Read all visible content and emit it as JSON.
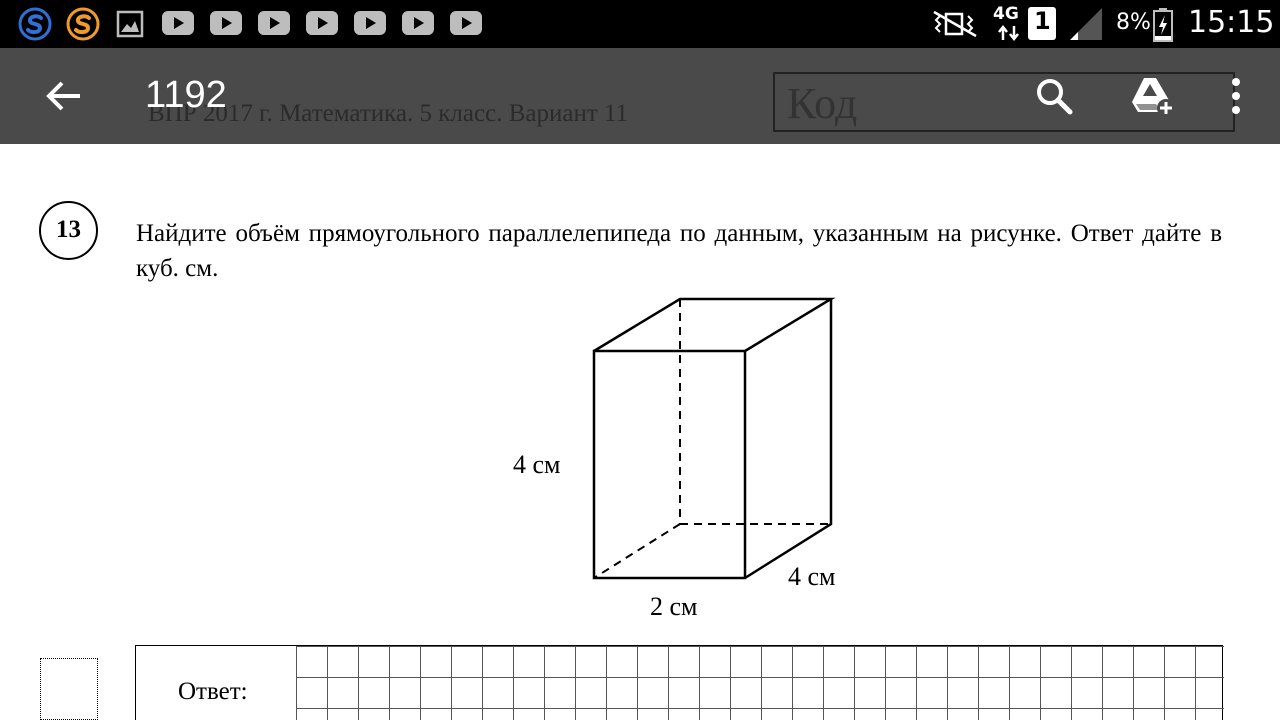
{
  "status_bar": {
    "notifications": [
      "s-app-icon-blue",
      "s-app-icon-orange",
      "gallery-icon",
      "youtube-icon",
      "youtube-icon",
      "youtube-icon",
      "youtube-icon",
      "youtube-icon",
      "youtube-icon",
      "youtube-icon"
    ],
    "network_type": "4G",
    "sim_slot": "1",
    "battery_percent": "8%",
    "time": "15:15",
    "colors": {
      "s_blue": "#2f6fd6",
      "s_orange": "#f09a2a"
    }
  },
  "app_bar": {
    "title": "1192",
    "back_icon": "arrow-back-icon",
    "search_icon": "search-icon",
    "drive_icon": "add-to-drive-icon",
    "menu_icon": "more-vert-icon",
    "background": "#4a4a4a"
  },
  "document": {
    "header_peek": "ВПР 2017 г. Математика. 5 класс. Вариант 11",
    "code_box_text": "Код",
    "problem_number": "13",
    "problem_text": "Найдите объём прямоугольного параллелепипеда по данным, указанным на рисунке. Ответ дайте в куб. см.",
    "figure": {
      "height_label": "4 см",
      "width_label": "2 см",
      "depth_label": "4 см"
    },
    "answer_label": "Ответ:"
  }
}
